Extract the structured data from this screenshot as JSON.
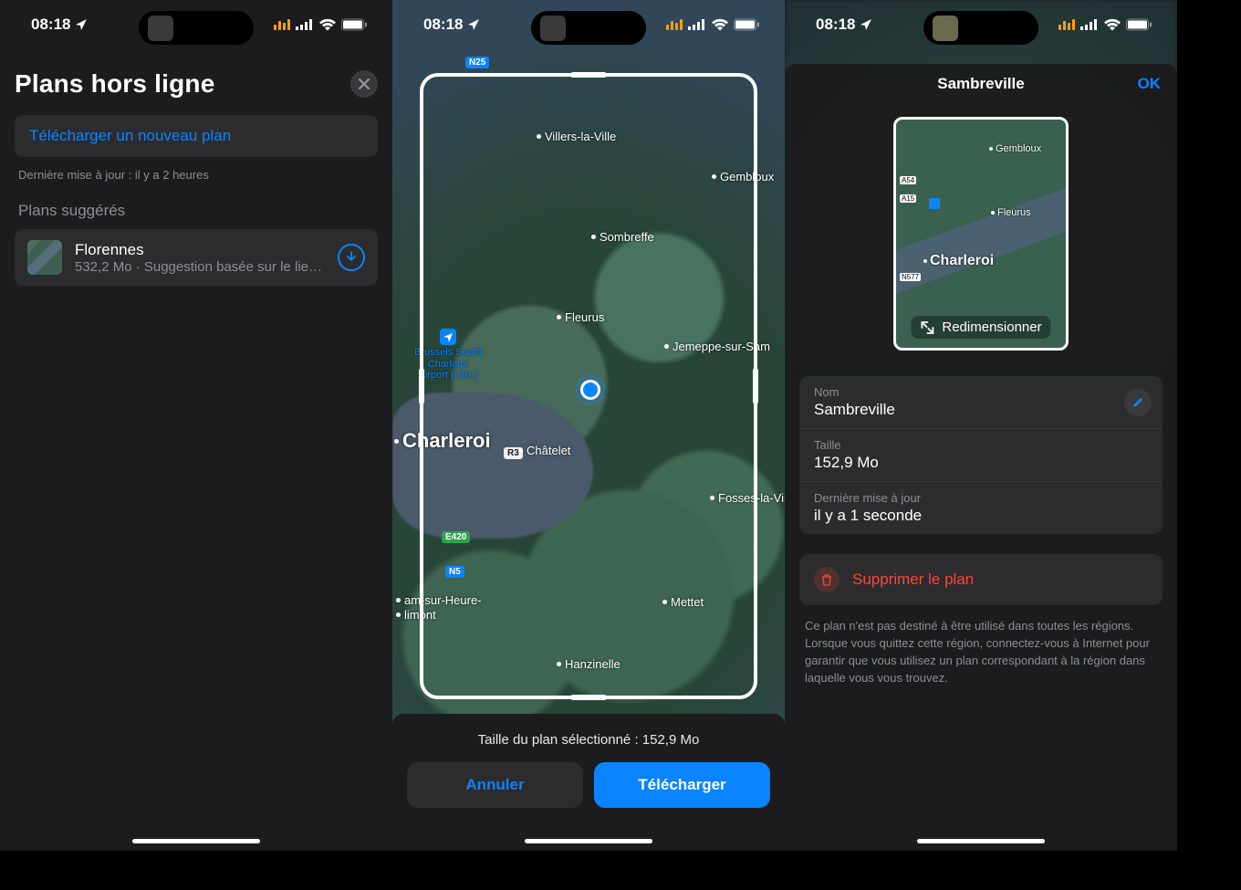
{
  "status": {
    "time": "08:18"
  },
  "screen1": {
    "title": "Plans hors ligne",
    "download_new": "Télécharger un nouveau plan",
    "last_update": "Dernière mise à jour : il y a 2 heures",
    "section": "Plans suggérés",
    "item": {
      "title": "Florennes",
      "subtitle": "532,2 Mo · Suggestion basée sur le lie…"
    }
  },
  "screen2": {
    "size_line": "Taille du plan sélectionné : 152,9 Mo",
    "cancel": "Annuler",
    "download": "Télécharger",
    "places": {
      "villers": "Villers-la-Ville",
      "gembloux": "Gembloux",
      "sombreffe": "Sombreffe",
      "fleurus": "Fleurus",
      "jemeppe": "Jemeppe-sur-Sam",
      "charleroi": "Charleroi",
      "chatelet": "Châtelet",
      "fosses": "Fosses-la-Ville",
      "ham": "am-sur-Heure-",
      "ham2": "limont",
      "mettet": "Mettet",
      "hanzinelle": "Hanzinelle",
      "airport_l1": "Brussels South",
      "airport_l2": "Charleroi",
      "airport_l3": "Airport (CRL)"
    },
    "roads": {
      "n25": "N25",
      "r3": "R3",
      "e420": "E420",
      "n5": "N5"
    }
  },
  "screen3": {
    "header_title": "Sambreville",
    "ok": "OK",
    "resize": "Redimensionner",
    "preview_places": {
      "gembloux": "Gembloux",
      "fleurus": "Fleurus",
      "charleroi": "Charleroi"
    },
    "preview_roads": {
      "a54": "A54",
      "a15": "A15",
      "n577": "N577"
    },
    "name_label": "Nom",
    "name_value": "Sambreville",
    "size_label": "Taille",
    "size_value": "152,9 Mo",
    "updated_label": "Dernière mise à jour",
    "updated_value": "il y a 1 seconde",
    "delete": "Supprimer le plan",
    "disclaimer": "Ce plan n'est pas destiné à être utilisé dans toutes les régions. Lorsque vous quittez cette région, connectez-vous à Internet pour garantir que vous utilisez un plan correspondant à la région dans laquelle vous vous trouvez."
  }
}
